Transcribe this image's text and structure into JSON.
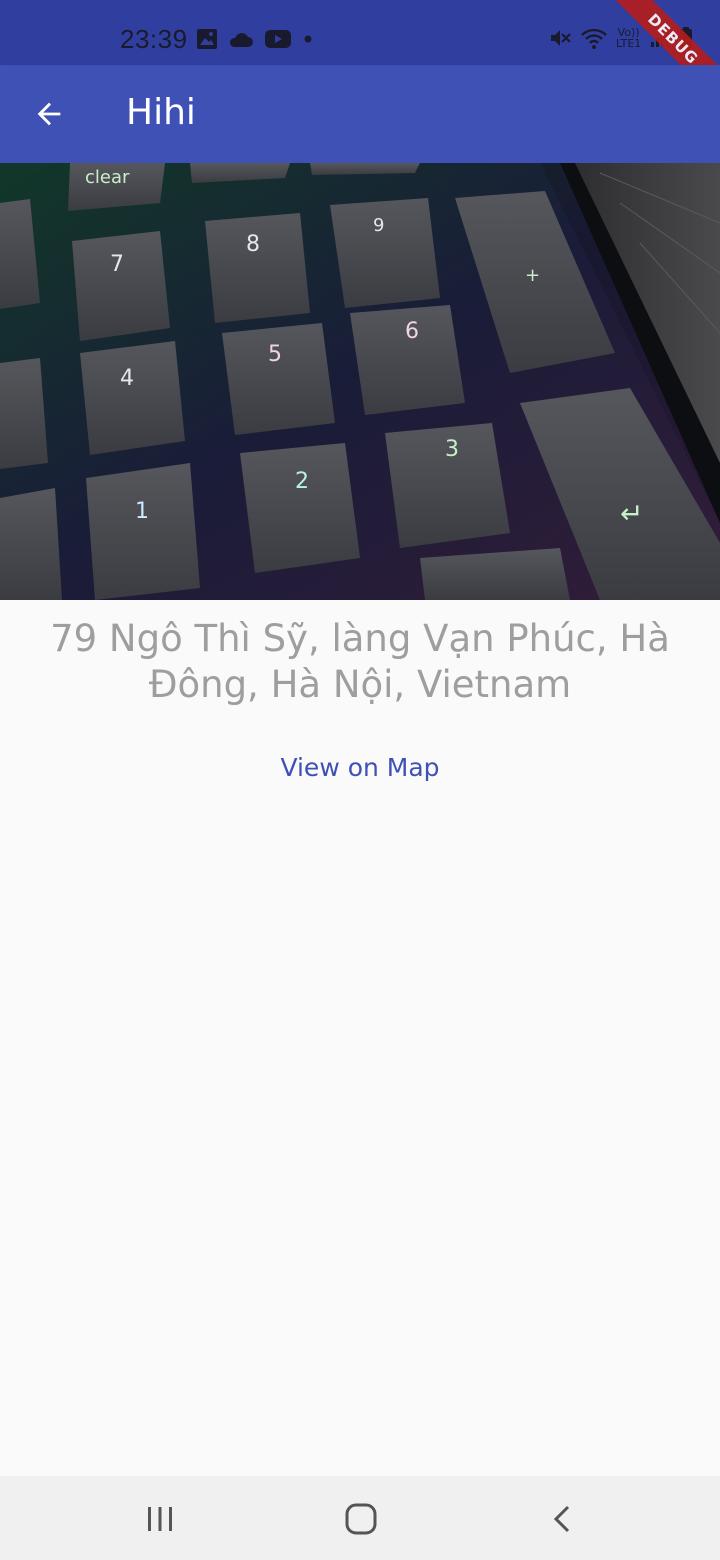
{
  "status_bar": {
    "time": "23:39",
    "left_icons": [
      "image-icon",
      "cloud-icon",
      "youtube-icon",
      "notification-dot-icon"
    ],
    "right_icons": [
      "mute-icon",
      "wifi-icon",
      "volte-lte-icon",
      "signal-icon",
      "battery-icon"
    ],
    "volte_label": "Vo))",
    "lte_label": "LTE1",
    "debug_banner": "DEBUG",
    "colors": {
      "background": "#303f9f"
    }
  },
  "app_bar": {
    "title": "Hihi",
    "back_icon": "arrow-back-icon",
    "colors": {
      "background": "#3f51b5",
      "foreground": "#ffffff"
    }
  },
  "photo": {
    "subject": "keyboard-keys-rgb",
    "key_labels": [
      "clear",
      "7",
      "8",
      "9",
      "4",
      "5",
      "6",
      "+",
      "1",
      "2",
      "3",
      "↵"
    ]
  },
  "location": {
    "address": "79 Ngô Thì Sỹ, làng Vạn Phúc, Hà Đông, Hà Nội, Vietnam",
    "address_color": "#9e9e9e"
  },
  "actions": {
    "view_on_map_label": "View on Map",
    "accent": "#3f51b5"
  },
  "nav_bar": {
    "buttons": [
      "recent-apps-icon",
      "home-icon",
      "back-nav-icon"
    ]
  }
}
